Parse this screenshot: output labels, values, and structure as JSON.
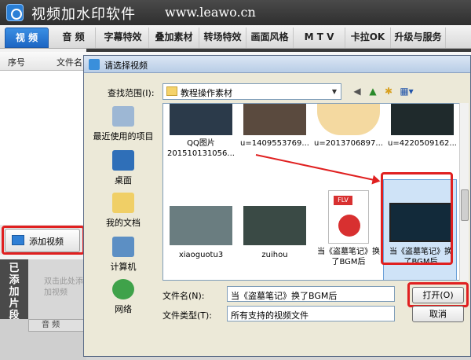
{
  "app": {
    "title": "视频加水印软件",
    "url": "www.leawo.cn",
    "tabs": [
      "视 频",
      "音 频",
      "字幕特效",
      "叠加素材",
      "转场特效",
      "画面风格",
      "M T V",
      "卡拉OK",
      "升级与服务"
    ],
    "columns": [
      "序号",
      "文件名"
    ],
    "add_video_label": "添加视频",
    "added_clips_label": "已添加片段",
    "drop_hint": "双击此处添加视频",
    "audio_label": "音 频"
  },
  "dialog": {
    "title": "请选择视频",
    "lookin_label": "查找范围(I):",
    "lookin_value": "教程操作素材",
    "places": [
      "最近使用的项目",
      "桌面",
      "我的文档",
      "计算机",
      "网络"
    ],
    "files": [
      {
        "name": "QQ图片\n201510131056..."
      },
      {
        "name": "u=1409553769..."
      },
      {
        "name": "u=2013706897..."
      },
      {
        "name": "u=4220509162..."
      },
      {
        "name": "xiaoguotu3"
      },
      {
        "name": "zuihou"
      },
      {
        "name": "当《盗墓笔记》换\n了BGM后"
      },
      {
        "name": "当《盗墓笔记》换\n了BGM后"
      }
    ],
    "flv_badge": "FLV",
    "filename_label": "文件名(N):",
    "filename_value": "当《盗墓笔记》换了BGM后",
    "filetype_label": "文件类型(T):",
    "filetype_value": "所有支持的视频文件",
    "open_label": "打开(O)",
    "cancel_label": "取消"
  },
  "colors": {
    "highlight_red": "#e02020",
    "tab_active": "#1d66c3"
  }
}
